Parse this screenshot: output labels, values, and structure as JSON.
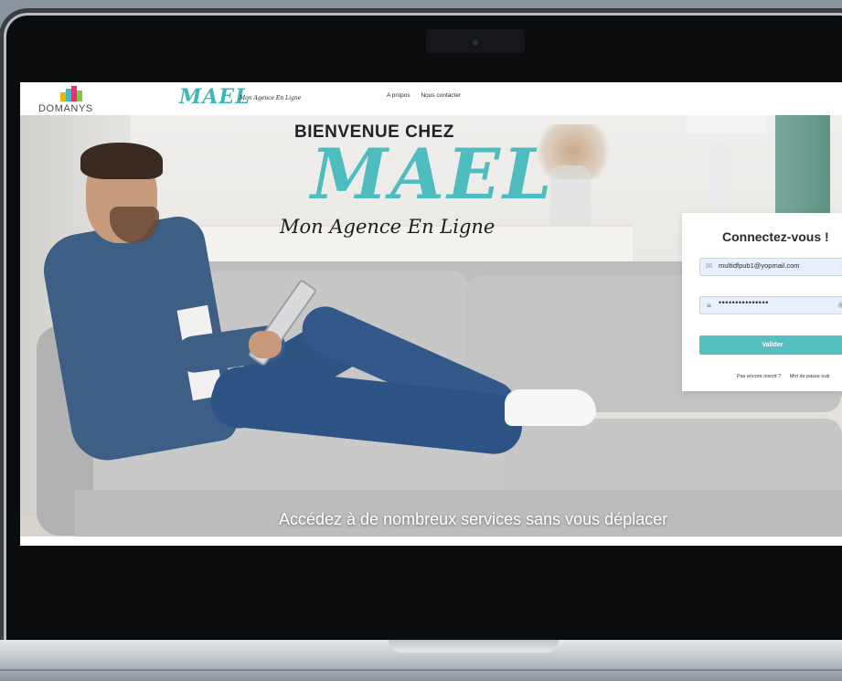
{
  "header": {
    "domanys_text": "DOMANYS",
    "mael_logo": "MAEL",
    "mael_tag": "Mon Agence En Ligne",
    "nav": [
      "A propos",
      "Nous contacter"
    ]
  },
  "hero": {
    "welcome": "BIENVENUE CHEZ",
    "brand": "MAEL",
    "tagline": "Mon Agence En Ligne",
    "caption": "Accédez à de nombreux services sans vous déplacer"
  },
  "login": {
    "title": "Connectez-vous !",
    "email_value": "multidfpub1@yopmail.com",
    "password_value": "•••••••••••••••",
    "submit_label": "Valider",
    "link_register": "Pas encore inscrit ?",
    "link_forgot": "Mot de passe oub"
  },
  "colors": {
    "accent": "#56bfc1",
    "brand_teal": "#4fbdc0"
  },
  "icons": {
    "email": "envelope-icon",
    "password": "lock-icon",
    "toggle": "eye-icon"
  }
}
